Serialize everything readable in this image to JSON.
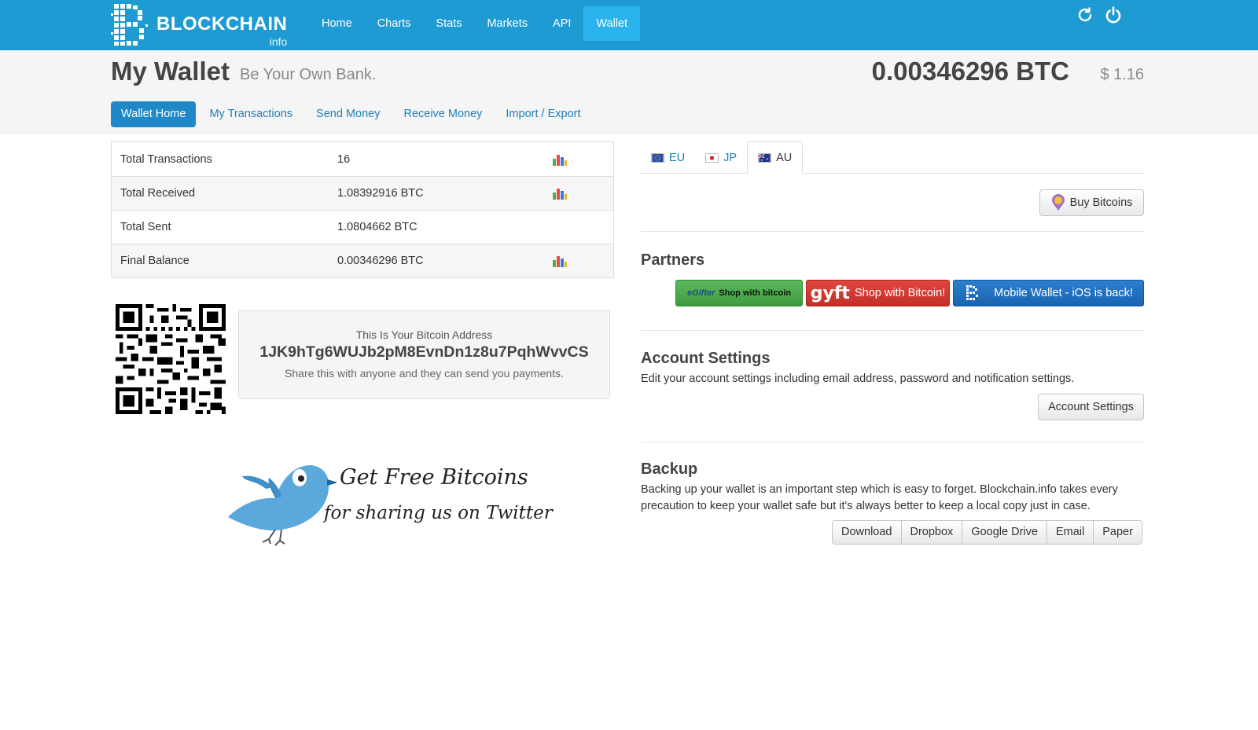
{
  "app": {
    "logo_name": "BLOCKCHAIN",
    "logo_sub": "info",
    "brand_color": "#1e9bd3"
  },
  "nav": {
    "items": [
      {
        "label": "Home",
        "active": false
      },
      {
        "label": "Charts",
        "active": false
      },
      {
        "label": "Stats",
        "active": false
      },
      {
        "label": "Markets",
        "active": false
      },
      {
        "label": "API",
        "active": false
      },
      {
        "label": "Wallet",
        "active": true
      }
    ],
    "icons": [
      "refresh-icon",
      "power-icon"
    ]
  },
  "header": {
    "title": "My Wallet",
    "subtitle": "Be Your Own Bank.",
    "balance_btc": "0.00346296 BTC",
    "balance_usd": "$ 1.16"
  },
  "subnav": {
    "items": [
      {
        "label": "Wallet Home",
        "active": true
      },
      {
        "label": "My Transactions",
        "active": false
      },
      {
        "label": "Send Money",
        "active": false
      },
      {
        "label": "Receive Money",
        "active": false
      },
      {
        "label": "Import / Export",
        "active": false
      }
    ]
  },
  "stats": {
    "rows": [
      {
        "label": "Total Transactions",
        "value": "16",
        "chart": true
      },
      {
        "label": "Total Received",
        "value": "1.08392916 BTC",
        "chart": true
      },
      {
        "label": "Total Sent",
        "value": "1.0804662 BTC",
        "chart": false
      },
      {
        "label": "Final Balance",
        "value": "0.00346296 BTC",
        "chart": true
      }
    ]
  },
  "address": {
    "title": "This Is Your Bitcoin Address",
    "value": "1JK9hTg6WUJb2pM8EvnDn1z8u7PqhWvvCS",
    "hint": "Share this with anyone and they can send you payments."
  },
  "promo": {
    "line1": "Get Free Bitcoins",
    "line2": "for sharing us on Twitter"
  },
  "region_tabs": [
    {
      "label": "EU",
      "active": false
    },
    {
      "label": "JP",
      "active": false
    },
    {
      "label": "AU",
      "active": true
    }
  ],
  "buy": {
    "label": "Buy Bitcoins"
  },
  "partners": {
    "title": "Partners",
    "egifter_label": "Shop with bitcoin",
    "egifter_brand": "eGifter",
    "gyft_brand": "gyft",
    "gyft_label": "Shop with Bitcoin!",
    "mobile_label": "Mobile Wallet - iOS is back!"
  },
  "account": {
    "title": "Account Settings",
    "text": "Edit your account settings including email address, password and notification settings.",
    "button": "Account Settings"
  },
  "backup": {
    "title": "Backup",
    "text": "Backing up your wallet is an important step which is easy to forget. Blockchain.info takes every precaution to keep your wallet safe but it's always better to keep a local copy just in case.",
    "buttons": [
      "Download",
      "Dropbox",
      "Google Drive",
      "Email",
      "Paper"
    ]
  }
}
